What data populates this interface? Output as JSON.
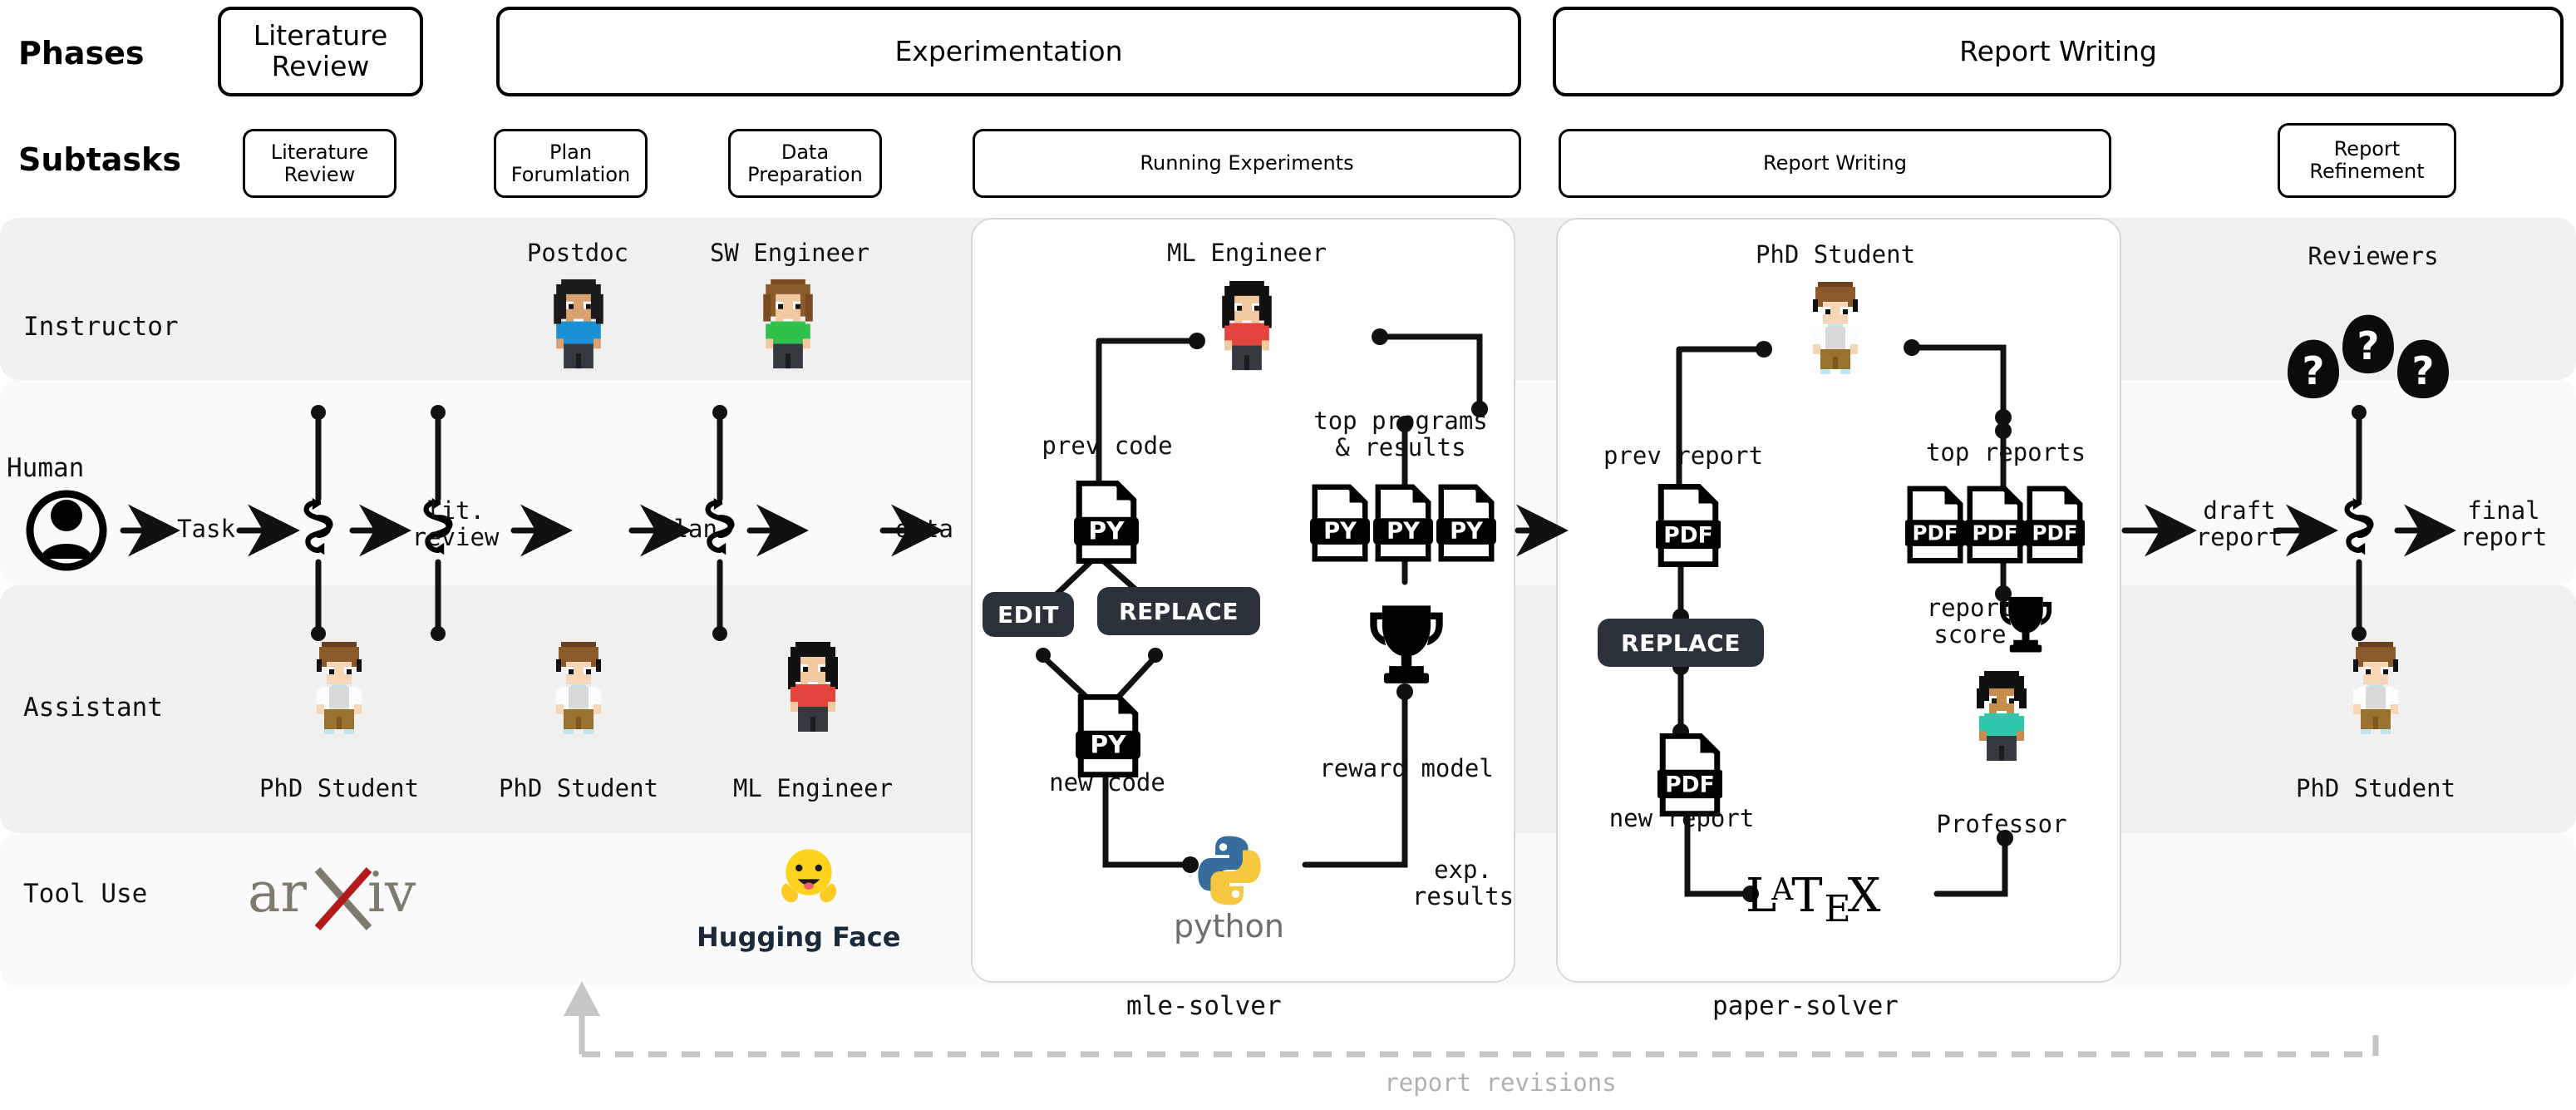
{
  "headers": {
    "phases_label": "Phases",
    "subtasks_label": "Subtasks"
  },
  "phases": [
    {
      "label": "Literature\nReview"
    },
    {
      "label": "Experimentation"
    },
    {
      "label": "Report Writing"
    }
  ],
  "subtasks": [
    {
      "label": "Literature\nReview"
    },
    {
      "label": "Plan\nForumlation"
    },
    {
      "label": "Data\nPreparation"
    },
    {
      "label": "Running Experiments"
    },
    {
      "label": "Report Writing"
    },
    {
      "label": "Report\nRefinement"
    }
  ],
  "rows": [
    {
      "label": "Instructor"
    },
    {
      "label": "Human"
    },
    {
      "label": "Assistant"
    },
    {
      "label": "Tool Use"
    }
  ],
  "instructor_agents": [
    {
      "name": "Postdoc"
    },
    {
      "name": "SW Engineer"
    },
    {
      "name": "Reviewers"
    }
  ],
  "assistant_agents": [
    {
      "name": "PhD Student"
    },
    {
      "name": "PhD Student"
    },
    {
      "name": "ML Engineer"
    },
    {
      "name": "PhD Student"
    }
  ],
  "pipeline": [
    {
      "label": "Task"
    },
    {
      "label": "lit.\nreview"
    },
    {
      "label": "plan"
    },
    {
      "label": "data"
    },
    {
      "label": "draft\nreport"
    },
    {
      "label": "final\nreport"
    }
  ],
  "mle_solver": {
    "name": "mle-solver",
    "agent": "ML Engineer",
    "prev_code_label": "prev code",
    "top_programs_label": "top programs\n& results",
    "new_code_label": "new code",
    "reward_model_label": "reward model",
    "exp_results_label": "exp.\nresults",
    "actions": [
      "EDIT",
      "REPLACE"
    ],
    "file_badges": [
      "PY",
      "PY",
      "PY",
      "PY"
    ],
    "prev_file_badge": "PY",
    "new_file_badge": "PY"
  },
  "paper_solver": {
    "name": "paper-solver",
    "agent": "PhD Student",
    "prev_report_label": "prev report",
    "top_reports_label": "top reports",
    "new_report_label": "new report",
    "report_score_label": "report\nscore",
    "professor_label": "Professor",
    "actions": [
      "REPLACE"
    ],
    "file_badges": [
      "PDF",
      "PDF",
      "PDF"
    ],
    "prev_file_badge": "PDF",
    "new_file_badge": "PDF",
    "latex_label": "LaTeX"
  },
  "tools": [
    {
      "name": "arxiv-logo",
      "label": "arXiv"
    },
    {
      "name": "hugging-face-logo",
      "label": "Hugging Face"
    },
    {
      "name": "python-logo",
      "label": "python"
    },
    {
      "name": "latex-logo",
      "label": "LaTeX"
    }
  ],
  "footer": {
    "revisions_label": "report revisions"
  },
  "colors": {
    "band_grey": "#f0f0f0",
    "band_white": "#fafafa",
    "pill_dark": "#2b323b",
    "arxiv_grey": "#7f7a6e",
    "arxiv_red": "#b31b1b",
    "hf_yellow": "#ffd21e",
    "python_blue": "#366d9c",
    "python_yellow": "#f5c840",
    "line": "#111111",
    "dashed": "#c6c6c6"
  }
}
